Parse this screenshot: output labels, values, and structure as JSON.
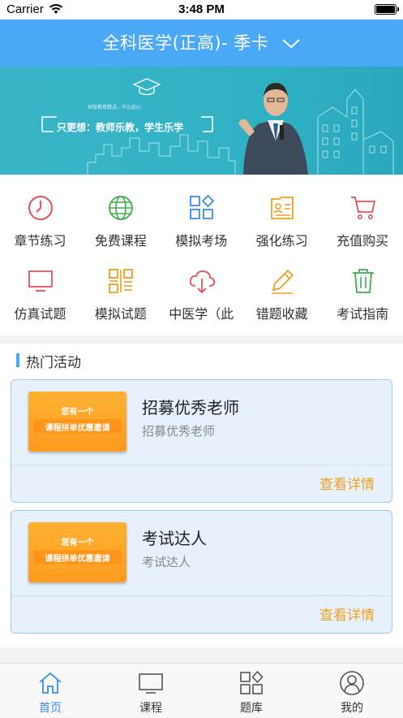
{
  "status": {
    "carrier": "Carrier",
    "time": "3:48 PM"
  },
  "header": {
    "title": "全科医学(正高)- 季卡"
  },
  "banner": {
    "slogan": "只更想：教师乐教，学生乐学",
    "small_text": "恒智教育精讲，不忘初心"
  },
  "grid": [
    {
      "label": "章节练习",
      "icon": "clock-icon",
      "color": "#e8505b"
    },
    {
      "label": "免费课程",
      "icon": "globe-icon",
      "color": "#3fae4a"
    },
    {
      "label": "模拟考场",
      "icon": "apps-icon",
      "color": "#3a8ee6"
    },
    {
      "label": "强化练习",
      "icon": "id-card-icon",
      "color": "#f0a020"
    },
    {
      "label": "充值购买",
      "icon": "cart-icon",
      "color": "#e8505b"
    },
    {
      "label": "仿真试题",
      "icon": "monitor-icon",
      "color": "#e8505b"
    },
    {
      "label": "模拟试题",
      "icon": "qrcode-icon",
      "color": "#f0a020"
    },
    {
      "label": "中医学（此",
      "icon": "cloud-download-icon",
      "color": "#e8505b"
    },
    {
      "label": "错题收藏",
      "icon": "pencil-icon",
      "color": "#f0a020"
    },
    {
      "label": "考试指南",
      "icon": "trash-icon",
      "color": "#3fae4a"
    }
  ],
  "hot": {
    "title": "热门活动",
    "cards": [
      {
        "thumb_line1": "您有一个",
        "thumb_line2": "课程拼单优惠邀请",
        "title": "招募优秀老师",
        "subtitle": "招募优秀老师",
        "more": "查看详情"
      },
      {
        "thumb_line1": "您有一个",
        "thumb_line2": "课程拼单优惠邀请",
        "title": "考试达人",
        "subtitle": "考试达人",
        "more": "查看详情"
      }
    ]
  },
  "tabs": [
    {
      "label": "首页",
      "icon": "home-icon",
      "active": true
    },
    {
      "label": "课程",
      "icon": "monitor-icon",
      "active": false
    },
    {
      "label": "题库",
      "icon": "apps-icon",
      "active": false
    },
    {
      "label": "我的",
      "icon": "user-icon",
      "active": false
    }
  ],
  "colors": {
    "accent": "#4aa8f6",
    "link": "#f0a020",
    "active_tab": "#3a8ee6"
  }
}
